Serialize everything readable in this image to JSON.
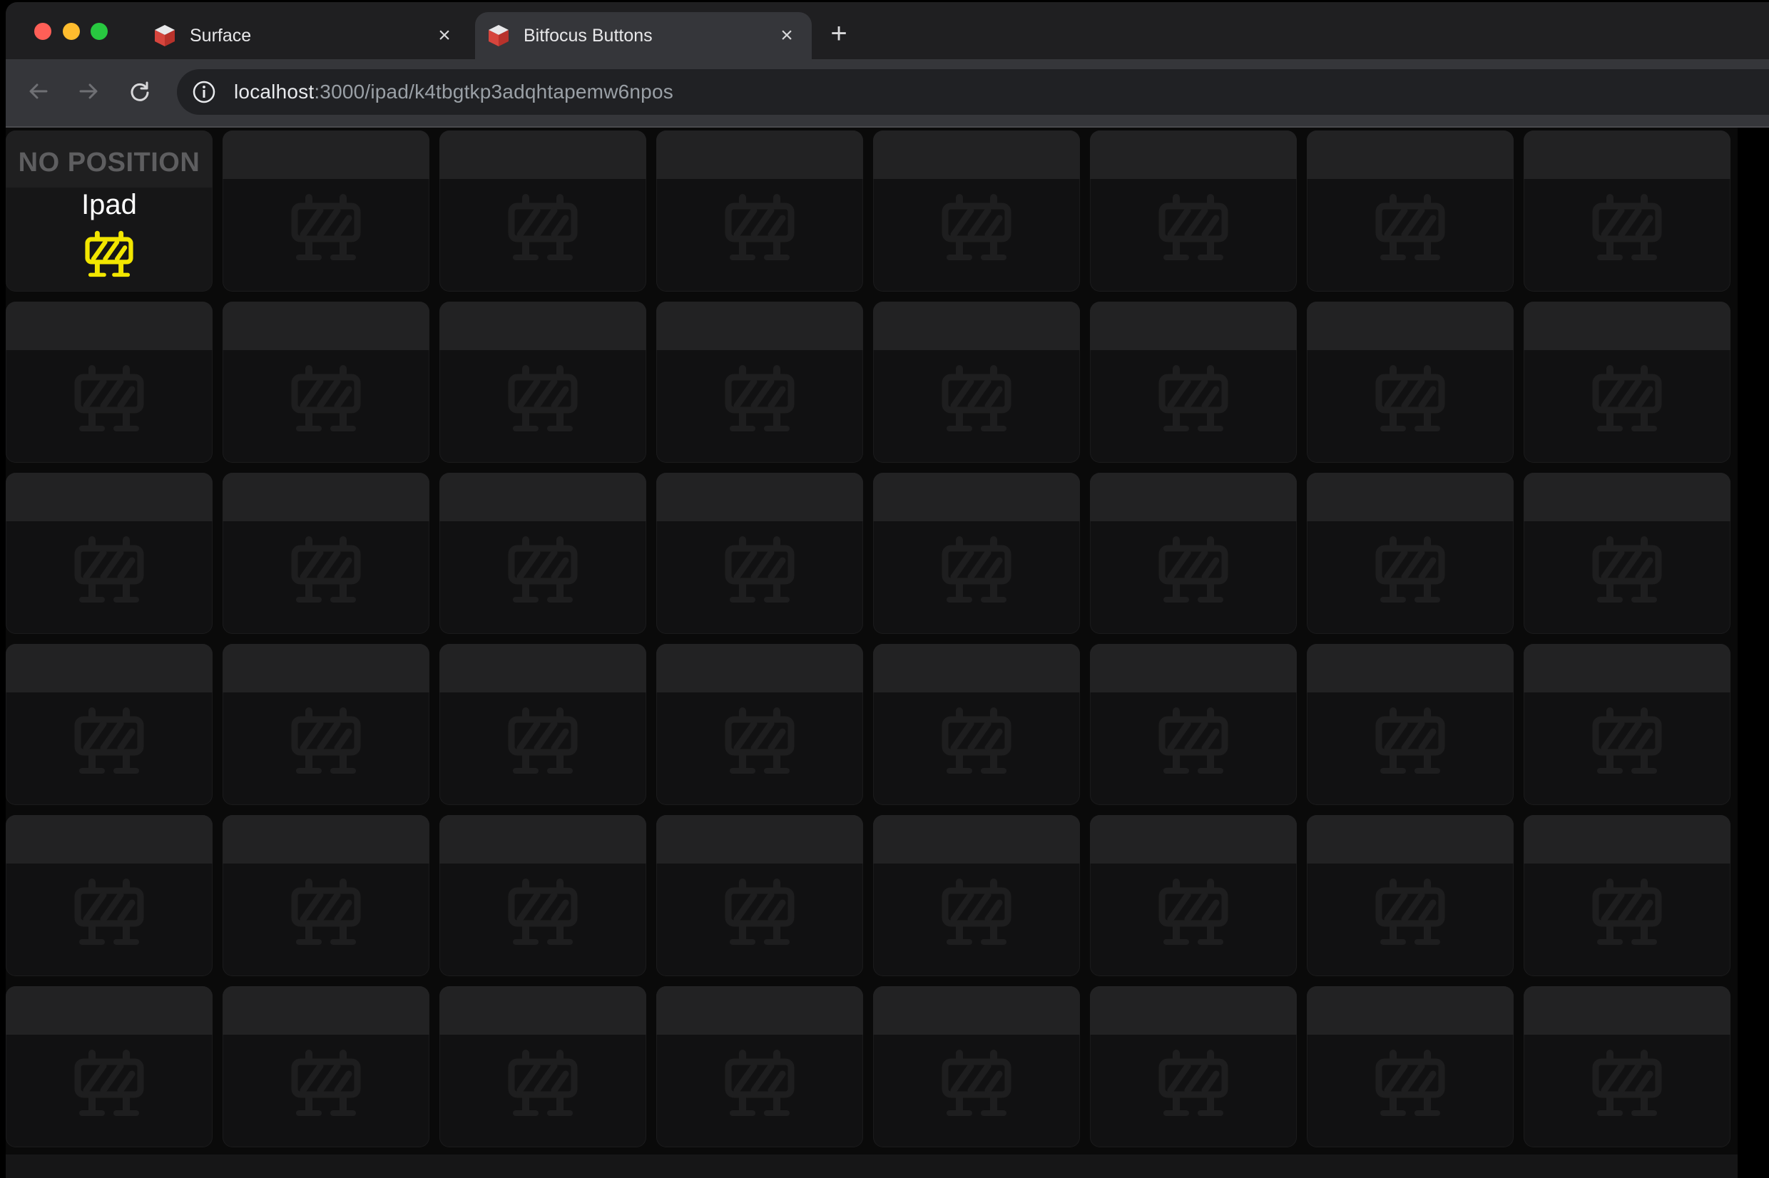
{
  "browser": {
    "tabs": [
      {
        "title": "Surface",
        "active": false,
        "favicon": "bitfocus-logo-icon"
      },
      {
        "title": "Bitfocus Buttons",
        "active": true,
        "favicon": "bitfocus-logo-icon"
      }
    ],
    "new_tab_label": "+",
    "close_label": "×",
    "url_host": "localhost",
    "url_rest": ":3000/ipad/k4tbgtkp3adqhtapemw6npos"
  },
  "surface": {
    "columns": 8,
    "rows": 6,
    "first_key": {
      "status_text": "NO POSITION",
      "name": "Ipad",
      "icon": "barrier-warning-icon",
      "icon_color": "#f2e600"
    },
    "empty_key_icon": "barrier-icon",
    "empty_key_icon_color": "#1e1e1f"
  }
}
